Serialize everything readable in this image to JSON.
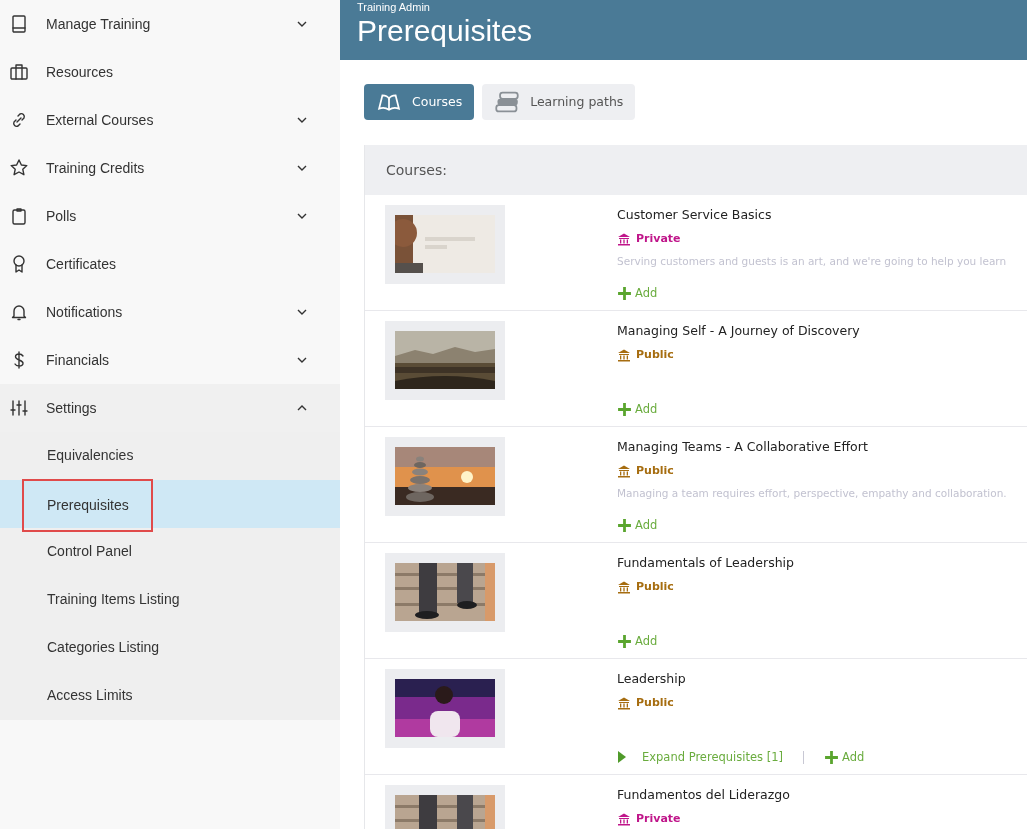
{
  "sidebar": {
    "items": [
      {
        "label": "Manage Training",
        "kind": "menu",
        "expanded": false
      },
      {
        "label": "Resources",
        "kind": "link"
      },
      {
        "label": "External Courses",
        "kind": "menu",
        "expanded": false
      },
      {
        "label": "Training Credits",
        "kind": "menu",
        "expanded": false
      },
      {
        "label": "Polls",
        "kind": "menu",
        "expanded": false
      },
      {
        "label": "Certificates",
        "kind": "link"
      },
      {
        "label": "Notifications",
        "kind": "menu",
        "expanded": false
      },
      {
        "label": "Financials",
        "kind": "menu",
        "expanded": false
      },
      {
        "label": "Settings",
        "kind": "menu",
        "expanded": true,
        "children": [
          {
            "label": "Equivalencies",
            "selected": false
          },
          {
            "label": "Prerequisites",
            "selected": true
          },
          {
            "label": "Control Panel",
            "selected": false
          },
          {
            "label": "Training Items Listing",
            "selected": false
          },
          {
            "label": "Categories Listing",
            "selected": false
          },
          {
            "label": "Access Limits",
            "selected": false
          }
        ]
      }
    ]
  },
  "header": {
    "breadcrumb": "Training Admin",
    "title": "Prerequisites"
  },
  "tabs": [
    {
      "label": "Courses",
      "selected": true
    },
    {
      "label": "Learning paths",
      "selected": false
    }
  ],
  "panel": {
    "heading": "Courses:",
    "courses": [
      {
        "title": "Customer Service Basics",
        "visibility": {
          "label": "Private",
          "kind": "private"
        },
        "description": "Serving customers and guests is an art, and we're going to help you learn",
        "actions": [
          {
            "kind": "add",
            "label": "Add"
          }
        ]
      },
      {
        "title": "Managing Self - A Journey of Discovery",
        "visibility": {
          "label": "Public",
          "kind": "public"
        },
        "actions": [
          {
            "kind": "add",
            "label": "Add"
          }
        ]
      },
      {
        "title": "Managing Teams - A Collaborative Effort",
        "visibility": {
          "label": "Public",
          "kind": "public"
        },
        "description": "Managing a team requires effort, perspective, empathy and collaboration.",
        "actions": [
          {
            "kind": "add",
            "label": "Add"
          }
        ]
      },
      {
        "title": "Fundamentals of Leadership",
        "visibility": {
          "label": "Public",
          "kind": "public"
        },
        "actions": [
          {
            "kind": "add",
            "label": "Add"
          }
        ]
      },
      {
        "title": "Leadership",
        "visibility": {
          "label": "Public",
          "kind": "public"
        },
        "actions": [
          {
            "kind": "expand",
            "label": "Expand Prerequisites [1]"
          },
          {
            "kind": "add",
            "label": "Add"
          }
        ]
      },
      {
        "title": "Fundamentos del Liderazgo",
        "visibility": {
          "label": "Private",
          "kind": "private"
        }
      }
    ]
  }
}
